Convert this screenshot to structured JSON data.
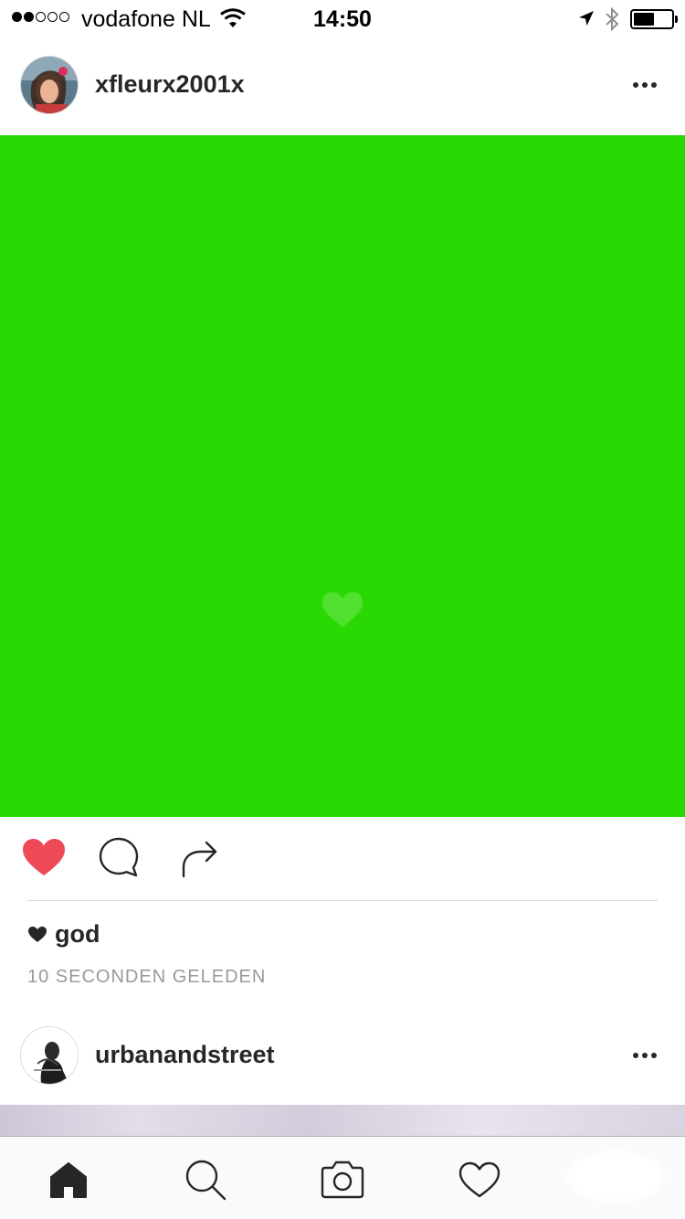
{
  "status_bar": {
    "carrier": "vodafone NL",
    "time": "14:50",
    "signal_strength": 2,
    "signal_max": 5,
    "battery_level": 0.55,
    "icons": [
      "wifi-icon",
      "location-arrow-icon",
      "bluetooth-icon",
      "battery-icon"
    ]
  },
  "posts": [
    {
      "username": "xfleurx2001x",
      "media_color": "#2ad903",
      "liked": true,
      "likes_text": "god",
      "timestamp": "10 SECONDEN GELEDEN"
    },
    {
      "username": "urbanandstreet"
    }
  ],
  "colors": {
    "like_red": "#ed4956",
    "text_primary": "#262626",
    "text_secondary": "#999999",
    "divider": "#dbdbdb"
  },
  "tab_bar": {
    "items": [
      "home-icon",
      "search-icon",
      "camera-icon",
      "activity-heart-icon",
      "profile-avatar"
    ]
  }
}
